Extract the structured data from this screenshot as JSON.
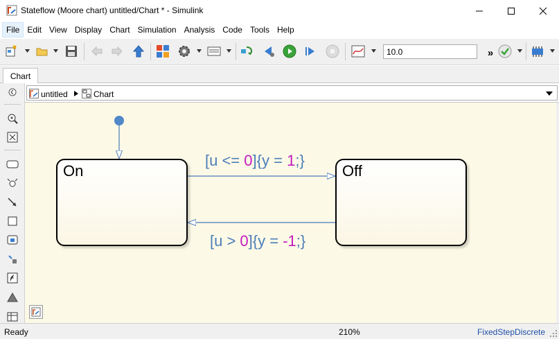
{
  "window": {
    "title": "Stateflow (Moore chart) untitled/Chart * - Simulink",
    "icons": [
      "stateflow-app-icon",
      "minimize-icon",
      "maximize-icon",
      "close-icon"
    ]
  },
  "menu": {
    "items": [
      "File",
      "Edit",
      "View",
      "Display",
      "Chart",
      "Simulation",
      "Analysis",
      "Code",
      "Tools",
      "Help"
    ],
    "active": "File"
  },
  "toolbar": {
    "stop_time": "10.0",
    "overflow": "»",
    "icons": [
      "new-model-icon",
      "open-folder-icon",
      "save-icon",
      "back-icon",
      "forward-icon",
      "up-to-parent-icon",
      "library-browser-icon",
      "model-settings-icon",
      "model-explorer-icon",
      "step-back-icon",
      "step-config-icon",
      "run-icon",
      "step-forward-icon",
      "stop-icon",
      "scope-icon",
      "check-icon",
      "build-icon"
    ]
  },
  "tabs": [
    {
      "label": "Chart"
    }
  ],
  "palette": {
    "icons": [
      "hide-palette-icon",
      "zoom-in-icon",
      "fit-to-view-icon",
      "state-tool-icon",
      "junction-tool-icon",
      "transition-tool-icon",
      "box-tool-icon",
      "simulink-function-icon",
      "history-junction-icon",
      "matlab-function-icon",
      "annotation-icon",
      "truth-table-icon"
    ]
  },
  "breadcrumb": {
    "items": [
      "untitled",
      "Chart"
    ]
  },
  "chart": {
    "states": [
      {
        "name": "On"
      },
      {
        "name": "Off"
      }
    ],
    "transitions": [
      {
        "pre": "[u <= ",
        "num1": "0",
        "mid": "]{y = ",
        "num2": "1",
        "post": ";}"
      },
      {
        "pre": "[u > ",
        "num1": "0",
        "mid": "]{y = ",
        "num2": "-1",
        "post": ";}"
      }
    ],
    "colors": {
      "canvas": "#fdf9e7",
      "transition": "#4a7db8",
      "literal": "#c21cbd",
      "default_dot": "#5088c8"
    }
  },
  "status": {
    "left": "Ready",
    "zoom": "210%",
    "solver": "FixedStepDiscrete"
  }
}
